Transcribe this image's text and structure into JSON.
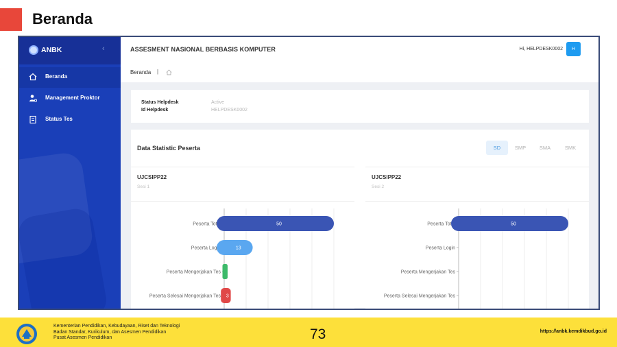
{
  "slide": {
    "title": "Beranda",
    "accent_color": "#e8473a"
  },
  "sidebar": {
    "brand": "ANBK",
    "toggle_glyph": "‹",
    "items": [
      {
        "label": "Beranda",
        "icon": "home-icon",
        "active": true
      },
      {
        "label": "Management Proktor",
        "icon": "user-gear-icon",
        "active": false
      },
      {
        "label": "Status Tes",
        "icon": "clipboard-icon",
        "active": false
      }
    ]
  },
  "topbar": {
    "title": "ASSESMENT NASIONAL BERBASIS KOMPUTER",
    "greeting": "Hi, HELPDESK0002",
    "avatar_initials": "H"
  },
  "breadcrumb": {
    "current": "Beranda",
    "separator": "|",
    "icon": "home-icon"
  },
  "status": {
    "fields": [
      {
        "label": "Status Helpdesk",
        "value": "Active"
      },
      {
        "label": "Id Helpdesk",
        "value": "HELPDESK0002"
      }
    ]
  },
  "stats": {
    "title": "Data Statistic Peserta",
    "levels": [
      "SD",
      "SMP",
      "SMA",
      "SMK"
    ],
    "active_level": "SD",
    "panels": [
      {
        "code": "UJCSIPP22",
        "session": "Sesi 1"
      },
      {
        "code": "UJCSIPP22",
        "session": "Sesi 2"
      }
    ]
  },
  "chart_data": [
    {
      "type": "bar",
      "orientation": "horizontal",
      "categories": [
        "Peserta Total",
        "Peserta Login",
        "Peserta Mengerjakan Tes",
        "Peserta Selesai Mengerjakan Tes"
      ],
      "values": [
        50,
        13,
        1,
        3
      ],
      "data_labels": [
        "50",
        "13",
        "",
        "3"
      ],
      "colors": [
        "#3a55b4",
        "#5aa7f0",
        "#3dba6a",
        "#e04848"
      ],
      "xlim": [
        0,
        50
      ]
    },
    {
      "type": "bar",
      "orientation": "horizontal",
      "categories": [
        "Peserta Total",
        "Peserta Login",
        "Peserta Mengerjakan Tes",
        "Peserta Selesai Mengerjakan Tes"
      ],
      "values": [
        50,
        0,
        0,
        0
      ],
      "data_labels": [
        "50",
        "",
        "",
        ""
      ],
      "colors": [
        "#3a55b4",
        "#5aa7f0",
        "#3dba6a",
        "#e04848"
      ],
      "xlim": [
        0,
        50
      ]
    }
  ],
  "footer": {
    "ministry_lines": [
      "Kementerian Pendidikan, Kebudayaan, Riset dan Teknologi",
      "Badan Standar, Kurikulum, dan Asesmen Pendidikan",
      "Pusat Asesmen Pendidikan"
    ],
    "page_number": "73",
    "url": "https://anbk.kemdikbud.go.id",
    "bar_color": "#fde03a"
  }
}
